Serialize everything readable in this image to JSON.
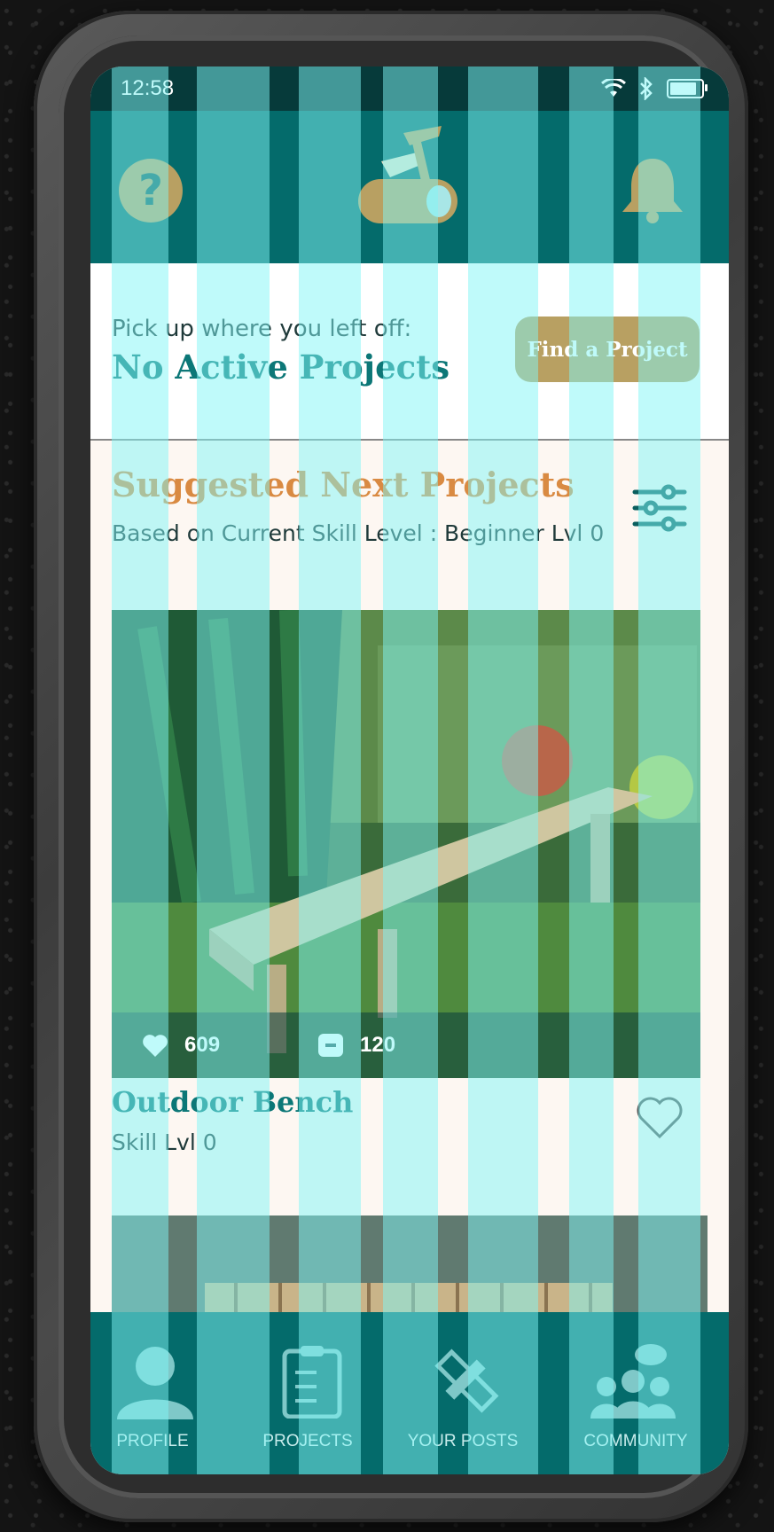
{
  "status_bar": {
    "time": "12:58",
    "battery_level": 0.85
  },
  "header": {
    "help_icon": "question-icon",
    "logo_icon": "axe-log-logo",
    "notifications_icon": "bell-icon",
    "help_glyph": "?"
  },
  "active_project": {
    "label": "Pick up where you left off:",
    "title": "No Active Projects",
    "button": "Find a Project"
  },
  "suggested": {
    "title": "Suggested Next Projects",
    "subtitle": "Based on Current Skill Level : Beginner Lvl 0",
    "filter_icon": "sliders-icon"
  },
  "cards": [
    {
      "title": "Outdoor Bench",
      "skill": "Skill Lvl 0",
      "likes": "609",
      "comments": "120",
      "favorite_icon": "heart-outline-icon"
    }
  ],
  "nav": [
    {
      "label": "PROFILE",
      "icon": "person-icon"
    },
    {
      "label": "PROJECTS",
      "icon": "clipboard-icon"
    },
    {
      "label": "YOUR POSTS",
      "icon": "pencil-ruler-icon"
    },
    {
      "label": "COMMUNITY",
      "icon": "community-icon"
    }
  ],
  "colors": {
    "header": "#046b6b",
    "accent_gold": "#b8a062",
    "title_teal": "#0c7777",
    "suggested_orange": "#d98a42",
    "overlay_cyan": "#7ff5f5"
  }
}
